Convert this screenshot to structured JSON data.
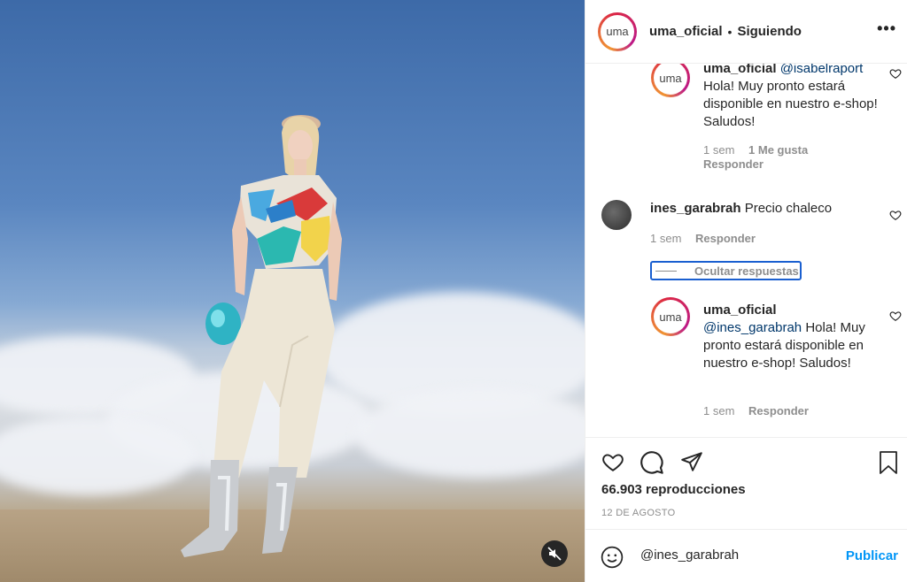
{
  "header": {
    "avatar_text": "uma",
    "username": "uma_oficial",
    "separator": "•",
    "follow_status": "Siguiendo",
    "more_icon": "more-dots-icon"
  },
  "comments": [
    {
      "avatar_text": "uma",
      "username": "uma_oficial",
      "mention": "@isabelraport",
      "text": "Hola! Muy pronto estará disponible en nuestro e-shop! Saludos!",
      "time": "1 sem",
      "likes": "1 Me gusta",
      "reply": "Responder"
    },
    {
      "username": "ines_garabrah",
      "text": "Precio chaleco",
      "time": "1 sem",
      "reply": "Responder"
    },
    {
      "avatar_text": "uma",
      "username": "uma_oficial",
      "mention": "@ines_garabrah",
      "text": "Hola! Muy pronto estará disponible en nuestro e-shop! Saludos!",
      "time": "1 sem",
      "reply": "Responder"
    }
  ],
  "hide_replies_label": "Ocultar respuestas",
  "stats": {
    "views": "66.903 reproducciones",
    "date": "12 DE AGOSTO"
  },
  "composer": {
    "value": "@ines_garabrah",
    "publish_label": "Publicar"
  },
  "colors": {
    "accent": "#0095f6",
    "mention": "#00376b",
    "muted": "#8e8e8e"
  }
}
